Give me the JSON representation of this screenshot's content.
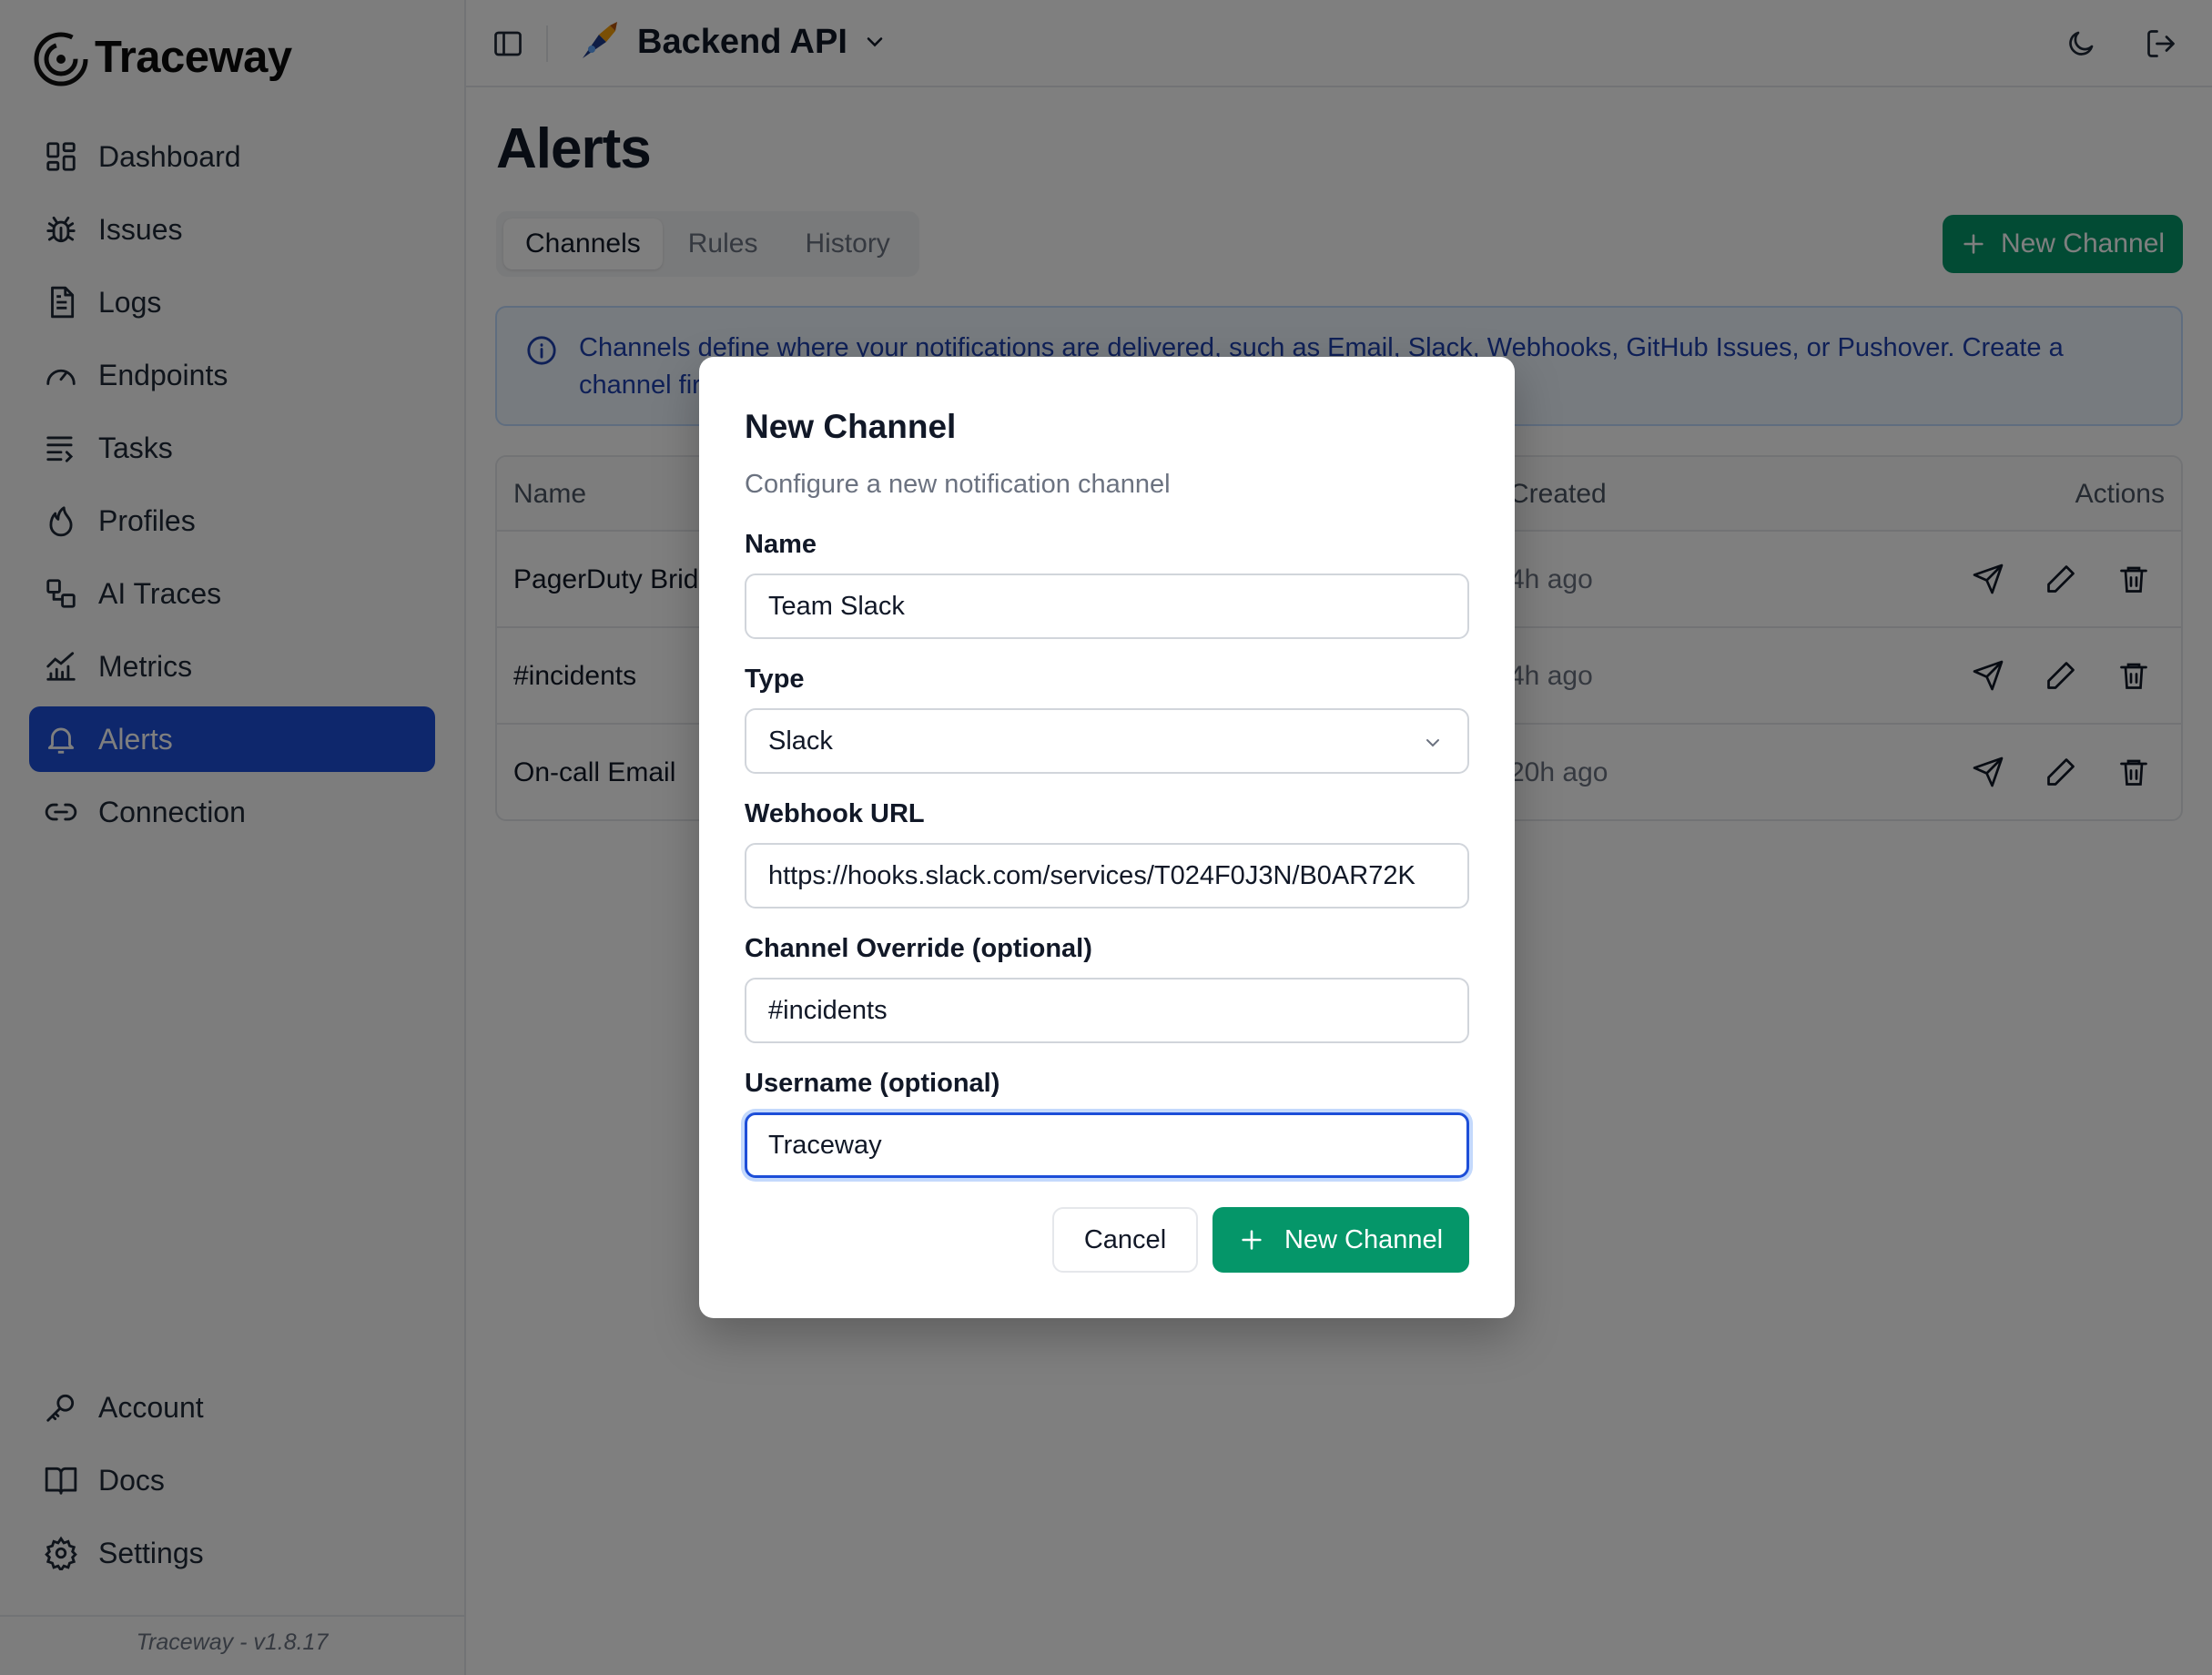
{
  "app": {
    "logo_text": "Traceway",
    "version_label": "Traceway - v1.8.17"
  },
  "sidebar": {
    "items": [
      {
        "label": "Dashboard",
        "icon": "dashboard-icon"
      },
      {
        "label": "Issues",
        "icon": "bug-icon"
      },
      {
        "label": "Logs",
        "icon": "file-text-icon"
      },
      {
        "label": "Endpoints",
        "icon": "gauge-icon"
      },
      {
        "label": "Tasks",
        "icon": "list-icon"
      },
      {
        "label": "Profiles",
        "icon": "flame-icon"
      },
      {
        "label": "AI Traces",
        "icon": "shapes-icon"
      },
      {
        "label": "Metrics",
        "icon": "bar-chart-icon"
      },
      {
        "label": "Alerts",
        "icon": "bell-icon",
        "active": true
      },
      {
        "label": "Connection",
        "icon": "link-icon"
      }
    ],
    "bottom_items": [
      {
        "label": "Account",
        "icon": "key-icon"
      },
      {
        "label": "Docs",
        "icon": "book-icon"
      },
      {
        "label": "Settings",
        "icon": "gear-icon"
      }
    ]
  },
  "topbar": {
    "project_name": "Backend API"
  },
  "page": {
    "title": "Alerts",
    "tabs": [
      "Channels",
      "Rules",
      "History"
    ],
    "active_tab": "Channels",
    "new_channel_button": "New Channel",
    "info_text": "Channels define where your notifications are delivered, such as Email, Slack, Webhooks, GitHub Issues, or Pushover. Create a channel first, then reference it in your alert rules."
  },
  "table": {
    "columns": {
      "name": "Name",
      "created": "Created",
      "actions": "Actions"
    },
    "rows": [
      {
        "name": "PagerDuty Bridge",
        "created": "4h ago"
      },
      {
        "name": "#incidents",
        "created": "4h ago"
      },
      {
        "name": "On-call Email",
        "created": "20h ago"
      }
    ]
  },
  "modal": {
    "title": "New Channel",
    "description": "Configure a new notification channel",
    "fields": {
      "name": {
        "label": "Name",
        "value": "Team Slack"
      },
      "type": {
        "label": "Type",
        "value": "Slack"
      },
      "webhook": {
        "label": "Webhook URL",
        "value": "https://hooks.slack.com/services/T024F0J3N/B0AR72K"
      },
      "channel_override": {
        "label": "Channel Override (optional)",
        "value": "#incidents"
      },
      "username": {
        "label": "Username (optional)",
        "value": "Traceway"
      }
    },
    "cancel_label": "Cancel",
    "submit_label": "New Channel"
  },
  "colors": {
    "accent_blue": "#1d4ed8",
    "brand_green": "#059669",
    "info_bg": "#eff6ff",
    "info_text": "#1e40af"
  }
}
